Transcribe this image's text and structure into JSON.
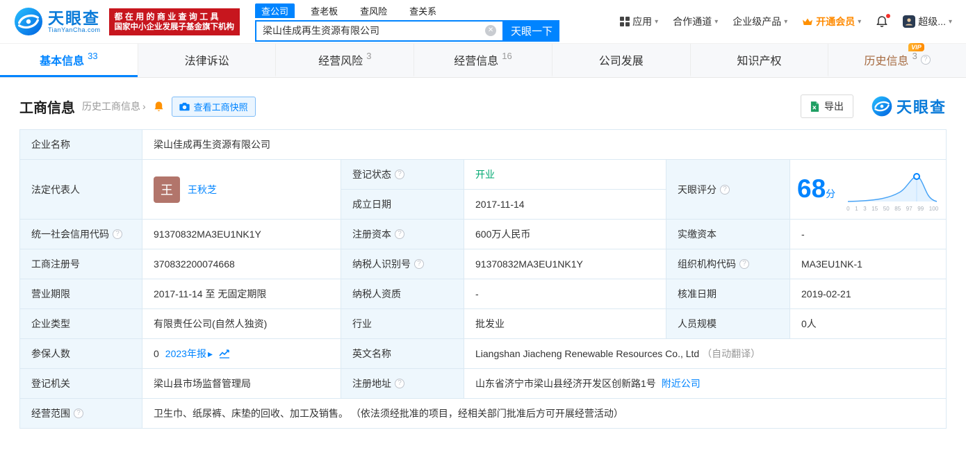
{
  "header": {
    "logo": {
      "name": "天眼查",
      "domain": "TianYanCha.com"
    },
    "badge": {
      "line1": "都 在 用 的 商 业 查 询 工 具",
      "line2": "国家中小企业发展子基金旗下机构"
    },
    "search_tabs": [
      {
        "label": "查公司"
      },
      {
        "label": "查老板"
      },
      {
        "label": "查风险"
      },
      {
        "label": "查关系"
      }
    ],
    "search": {
      "value": "梁山佳成再生资源有限公司",
      "button": "天眼一下"
    },
    "nav": [
      {
        "label": "应用"
      },
      {
        "label": "合作通道"
      },
      {
        "label": "企业级产品"
      },
      {
        "label": "开通会员"
      },
      {
        "label": "超级..."
      }
    ]
  },
  "tabs": [
    {
      "label": "基本信息",
      "count": "33"
    },
    {
      "label": "法律诉讼",
      "count": ""
    },
    {
      "label": "经营风险",
      "count": "3"
    },
    {
      "label": "经营信息",
      "count": "16"
    },
    {
      "label": "公司发展",
      "count": ""
    },
    {
      "label": "知识产权",
      "count": ""
    },
    {
      "label": "历史信息",
      "count": "3"
    }
  ],
  "toolbar": {
    "title": "工商信息",
    "history_link": "历史工商信息",
    "snapshot_button": "查看工商快照",
    "export_button": "导出",
    "brand": "天眼查"
  },
  "labels": {
    "name": "企业名称",
    "legal_rep": "法定代表人",
    "reg_status": "登记状态",
    "establish_date": "成立日期",
    "score": "天眼评分",
    "credit_code": "统一社会信用代码",
    "reg_capital": "注册资本",
    "paid_capital": "实缴资本",
    "reg_no": "工商注册号",
    "taxpayer_no": "纳税人识别号",
    "org_code": "组织机构代码",
    "term": "营业期限",
    "taxpayer_qual": "纳税人资质",
    "approval_date": "核准日期",
    "type": "企业类型",
    "industry": "行业",
    "staff": "人员规模",
    "insured": "参保人数",
    "english_name": "英文名称",
    "authority": "登记机关",
    "address": "注册地址",
    "scope": "经营范围"
  },
  "values": {
    "name": "梁山佳成再生资源有限公司",
    "legal_rep_initial": "王",
    "legal_rep": "王秋芝",
    "reg_status": "开业",
    "establish_date": "2017-11-14",
    "score": "68",
    "score_unit": "分",
    "credit_code": "91370832MA3EU1NK1Y",
    "reg_capital": "600万人民币",
    "paid_capital": "-",
    "reg_no": "370832200074668",
    "taxpayer_no": "91370832MA3EU1NK1Y",
    "org_code": "MA3EU1NK-1",
    "term": "2017-11-14 至 无固定期限",
    "taxpayer_qual": "-",
    "approval_date": "2019-02-21",
    "type": "有限责任公司(自然人独资)",
    "industry": "批发业",
    "staff": "0人",
    "insured": "0",
    "annual_report": "2023年报",
    "english_name": "Liangshan Jiacheng Renewable Resources Co., Ltd",
    "auto_translate": "（自动翻译）",
    "authority": "梁山县市场监督管理局",
    "address": "山东省济宁市梁山县经济开发区创新路1号",
    "nearby": "附近公司",
    "scope": "卫生巾、纸尿裤、床垫的回收、加工及销售。 （依法须经批准的项目，经相关部门批准后方可开展经营活动）"
  },
  "score_chart": {
    "ticks": [
      "0",
      "1",
      "3",
      "15",
      "50",
      "85",
      "97",
      "99",
      "100"
    ]
  },
  "icons": {
    "clear": "✕",
    "caret": "▾",
    "chevron": "›",
    "question": "?",
    "play": "▸",
    "vip": "VIP"
  },
  "colors": {
    "primary": "#0084ff",
    "green": "#00a870",
    "orange": "#ff8a00",
    "red": "#c7161e"
  }
}
